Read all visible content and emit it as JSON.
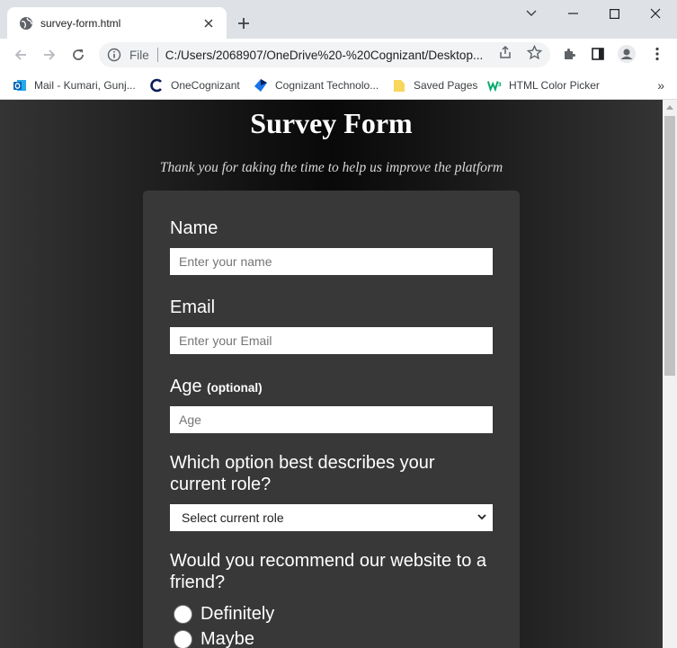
{
  "browser": {
    "tab_title": "survey-form.html",
    "scheme": "File",
    "url": "C:/Users/2068907/OneDrive%20-%20Cognizant/Desktop...",
    "bookmarks": [
      {
        "label": "Mail - Kumari, Gunj...",
        "icon": "outlook-icon"
      },
      {
        "label": "OneCognizant",
        "icon": "onecognizant-icon"
      },
      {
        "label": "Cognizant Technolo...",
        "icon": "cognizant-icon"
      },
      {
        "label": "Saved Pages",
        "icon": "folder-icon"
      },
      {
        "label": "HTML Color Picker",
        "icon": "w3schools-icon"
      }
    ]
  },
  "page": {
    "title": "Survey Form",
    "description": "Thank you for taking the time to help us improve the platform",
    "form": {
      "name_label": "Name",
      "name_placeholder": "Enter your name",
      "email_label": "Email",
      "email_placeholder": "Enter your Email",
      "age_label": "Age",
      "age_optional": "(optional)",
      "age_placeholder": "Age",
      "role_question": "Which option best describes your current role?",
      "role_selected": "Select current role",
      "recommend_question": "Would you recommend our website to a friend?",
      "recommend_options": [
        "Definitely",
        "Maybe"
      ]
    }
  },
  "colors": {
    "form_bg": "#383838",
    "page_bg": "#090909",
    "chrome_bg": "#dee1e6"
  }
}
